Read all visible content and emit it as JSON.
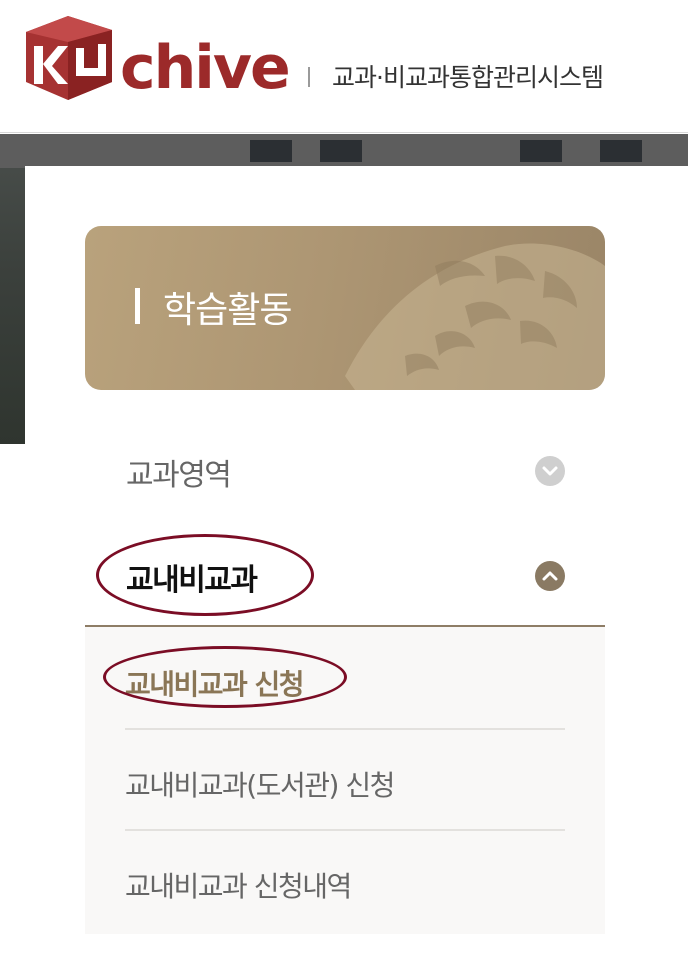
{
  "header": {
    "logo_text": "KUchive",
    "site_title": "교과·비교과통합관리시스템"
  },
  "colors": {
    "brand_red": "#9c2a2a",
    "gold": "#8a7656",
    "annotation": "#7b0d25"
  },
  "banner": {
    "title": "학습활동"
  },
  "menu": {
    "items": [
      {
        "label": "교과영역",
        "expanded": false,
        "icon": "chevron-down-icon"
      },
      {
        "label": "교내비교과",
        "expanded": true,
        "icon": "chevron-up-icon",
        "children": [
          {
            "label": "교내비교과 신청",
            "active": true
          },
          {
            "label": "교내비교과(도서관) 신청",
            "active": false
          },
          {
            "label": "교내비교과 신청내역",
            "active": false
          }
        ]
      }
    ]
  }
}
